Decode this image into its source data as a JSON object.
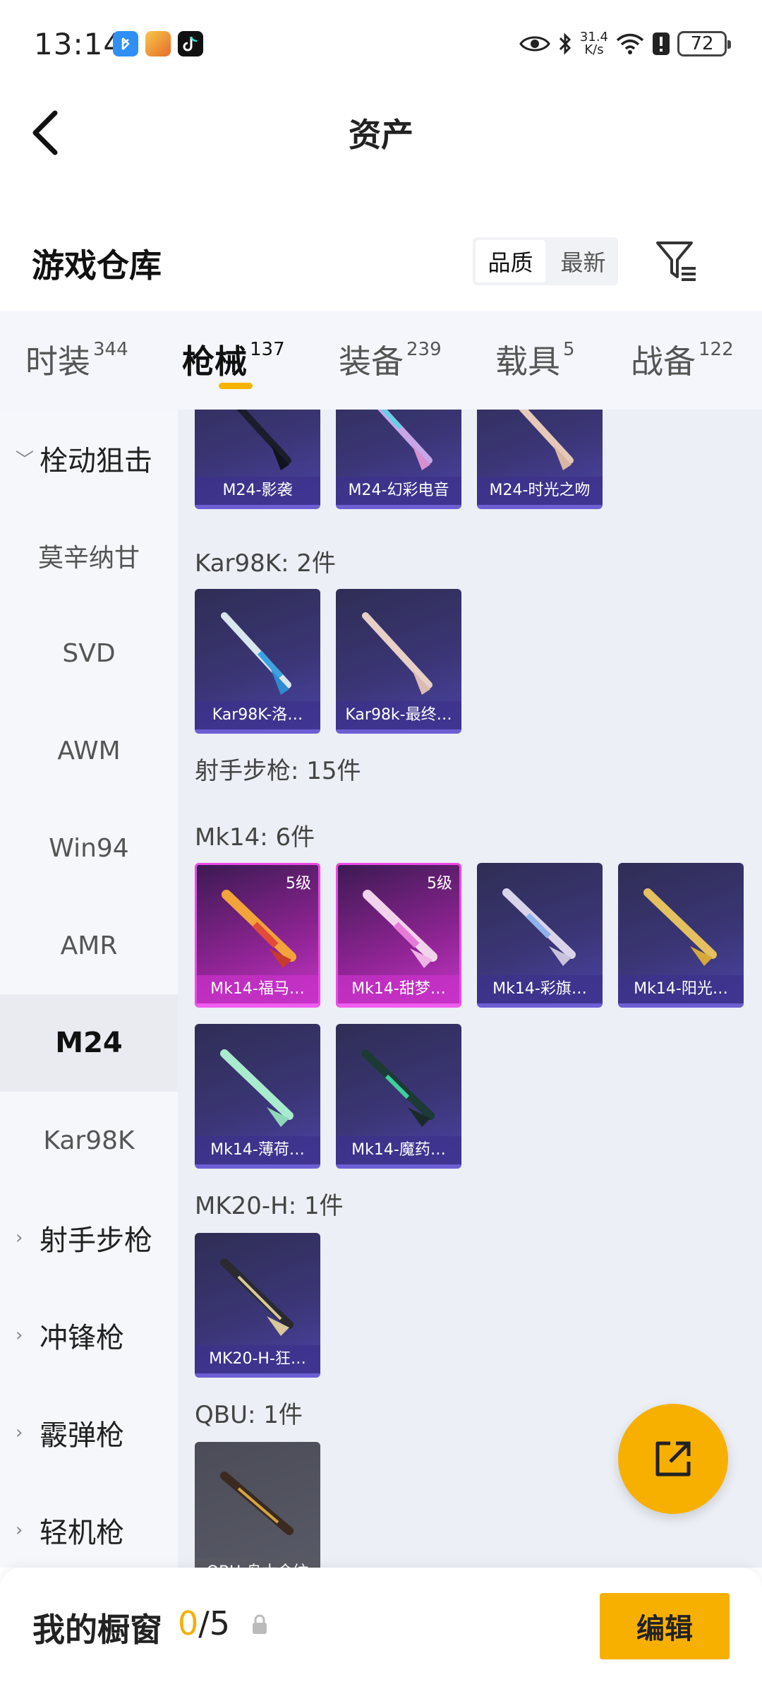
{
  "status_bar": {
    "time": "13:14",
    "netspeed_value": "31.4",
    "netspeed_unit": "K/s",
    "battery": "72",
    "icons": [
      "bluetooth-app-icon",
      "game-app-icon",
      "tiktok-icon",
      "eye-icon",
      "bluetooth-icon",
      "wifi-icon",
      "alert-icon",
      "battery-icon"
    ]
  },
  "header": {
    "title": "资产"
  },
  "warehouse": {
    "title": "游戏仓库",
    "sort_options": [
      "品质",
      "最新"
    ],
    "active_sort": "品质"
  },
  "category_tabs": [
    {
      "label": "时装",
      "count": "344"
    },
    {
      "label": "枪械",
      "count": "137",
      "active": true
    },
    {
      "label": "装备",
      "count": "239"
    },
    {
      "label": "载具",
      "count": "5"
    },
    {
      "label": "战备",
      "count": "122"
    }
  ],
  "sidebar": {
    "items": [
      {
        "label": "栓动狙击",
        "type": "group",
        "expanded": true
      },
      {
        "label": "莫辛纳甘",
        "type": "item"
      },
      {
        "label": "SVD",
        "type": "item"
      },
      {
        "label": "AWM",
        "type": "item"
      },
      {
        "label": "Win94",
        "type": "item"
      },
      {
        "label": "AMR",
        "type": "item"
      },
      {
        "label": "M24",
        "type": "item",
        "active": true
      },
      {
        "label": "Kar98K",
        "type": "item"
      },
      {
        "label": "射手步枪",
        "type": "group"
      },
      {
        "label": "冲锋枪",
        "type": "group"
      },
      {
        "label": "霰弹枪",
        "type": "group"
      },
      {
        "label": "轻机枪",
        "type": "group"
      }
    ]
  },
  "content": {
    "m24_items": [
      "M24-影袭",
      "M24-幻彩电音",
      "M24-时光之吻"
    ],
    "kar98k_header": "Kar98K: 2件",
    "kar98k_items": [
      "Kar98K-洛…",
      "Kar98k-最终…"
    ],
    "marksman_header": "射手步枪: 15件",
    "mk14_header": "Mk14: 6件",
    "mk14_items": [
      {
        "name": "Mk14-福马…",
        "level": "5级"
      },
      {
        "name": "Mk14-甜梦…",
        "level": "5级"
      },
      {
        "name": "Mk14-彩旗…"
      },
      {
        "name": "Mk14-阳光…"
      },
      {
        "name": "Mk14-薄荷…"
      },
      {
        "name": "Mk14-魔药…"
      }
    ],
    "mk20_header": "MK20-H: 1件",
    "mk20_items": [
      "MK20-H-狂…"
    ],
    "qbu_header": "QBU: 1件",
    "qbu_items": [
      "QBU-鸟木金纹"
    ]
  },
  "bottom_bar": {
    "label": "我的橱窗",
    "count_current": "0",
    "count_total": "/5",
    "edit_label": "编辑"
  },
  "colors": {
    "accent": "#f7b000",
    "sidebar_bg": "#f5f7fb",
    "content_bg": "#eceff5",
    "card_purple": "#3a3574",
    "card_gold": "#c436c6"
  }
}
